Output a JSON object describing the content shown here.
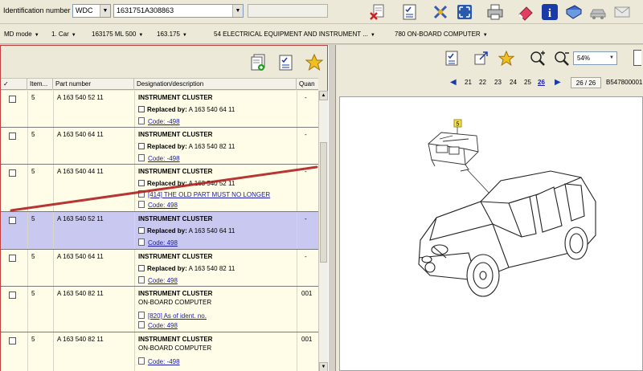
{
  "toolbar": {
    "id_label": "Identification number",
    "prefix_value": "WDC",
    "vin_value": "1631751A308863"
  },
  "nav": [
    {
      "label": "MD mode"
    },
    {
      "label": "1. Car"
    },
    {
      "label": "163175 ML 500"
    },
    {
      "label": "163.175"
    },
    {
      "label": "54 ELECTRICAL EQUIPMENT AND INSTRUMENT ..."
    },
    {
      "label": "780 ON-BOARD COMPUTER"
    }
  ],
  "grid": {
    "headers": [
      "✓",
      "Item...",
      "Part number",
      "Designation/description",
      "Quan"
    ],
    "rows": [
      {
        "item": "5",
        "part": "A 163 540 52 11",
        "title": "INSTRUMENT CLUSTER",
        "replaced_label": "Replaced by:",
        "replaced": "A 163 540 64 11",
        "code": "Code: -498",
        "qty": "-"
      },
      {
        "item": "5",
        "part": "A 163 540 64 11",
        "title": "INSTRUMENT CLUSTER",
        "replaced_label": "Replaced by:",
        "replaced": "A 163 540 82 11",
        "code": "Code: -498",
        "qty": "-"
      },
      {
        "item": "5",
        "part": "A 163 540 44 11",
        "title": "INSTRUMENT CLUSTER",
        "replaced_label": "Replaced by:",
        "replaced": "A 163 540 52 11",
        "note": "[414] THE OLD PART MUST NO LONGER",
        "code": "Code: 498",
        "qty": "-"
      },
      {
        "item": "5",
        "part": "A 163 540 52 11",
        "title": "INSTRUMENT CLUSTER",
        "replaced_label": "Replaced by:",
        "replaced": "A 163 540 64 11",
        "code": "Code: 498",
        "qty": "-"
      },
      {
        "item": "5",
        "part": "A 163 540 64 11",
        "title": "INSTRUMENT CLUSTER",
        "replaced_label": "Replaced by:",
        "replaced": "A 163 540 82 11",
        "code": "Code: 498",
        "qty": "-"
      },
      {
        "item": "5",
        "part": "A 163 540 82 11",
        "title": "INSTRUMENT CLUSTER",
        "subtitle": "ON-BOARD COMPUTER",
        "note": "[820] As of ident. no.",
        "code": "Code: 498",
        "qty": "001"
      },
      {
        "item": "5",
        "part": "A 163 540 82 11",
        "title": "INSTRUMENT CLUSTER",
        "subtitle": "ON-BOARD COMPUTER",
        "code": "Code: -498",
        "qty": "001"
      }
    ]
  },
  "viewer": {
    "zoom": "54%",
    "pages": [
      "21",
      "22",
      "23",
      "24",
      "25",
      "26"
    ],
    "current_page": "26",
    "page_count": "26 / 26",
    "doc_id": "B547800001",
    "callout": "5"
  },
  "colors": {
    "selected_row": "#c8c8f0",
    "row_bg": "#fffde8",
    "annotation_line": "#b02020",
    "link": "#1a1aa8"
  }
}
